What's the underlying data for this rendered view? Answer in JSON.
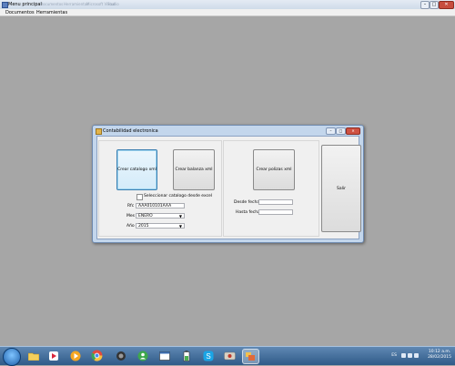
{
  "main_window": {
    "title": "Menu principal",
    "ghost_titles": [
      "Documentos",
      "Herramientas",
      "Microsoft Visual",
      "Studio"
    ],
    "controls": {
      "minimize": "–",
      "maximize": "□",
      "close": "✕"
    }
  },
  "menu": {
    "items": [
      "Documentos",
      "Herramientas"
    ]
  },
  "dialog": {
    "title": "Contabilidad electronica",
    "controls": {
      "minimize": "–",
      "maximize": "□",
      "close": "✕"
    },
    "buttons": {
      "crear_catalogo": "Crear catalogo xml",
      "crear_balanza": "Crear balanza xml",
      "crear_polizas": "Crear polizas xml",
      "salir": "Salir"
    },
    "checkbox_label": "Seleccionar catalogo desde excel",
    "fields": {
      "rfc_label": "Rfc",
      "rfc_value": "AAA010101AAA",
      "mes_label": "Mes",
      "mes_value": "ENERO",
      "anio_label": "Año",
      "anio_value": "2015",
      "desde_label": "Desde fecha",
      "desde_value": "",
      "hasta_label": "Hasta fecha",
      "hasta_value": ""
    }
  },
  "taskbar": {
    "icons": [
      "folder-icon",
      "media-player-icon",
      "chrome-icon",
      "game-icon",
      "user-icon",
      "window-icon",
      "battery-icon",
      "skype-icon",
      "app-icon",
      "visual-studio-icon"
    ],
    "language": "ES",
    "time": "10:12 a.m.",
    "date": "28/02/2015"
  }
}
